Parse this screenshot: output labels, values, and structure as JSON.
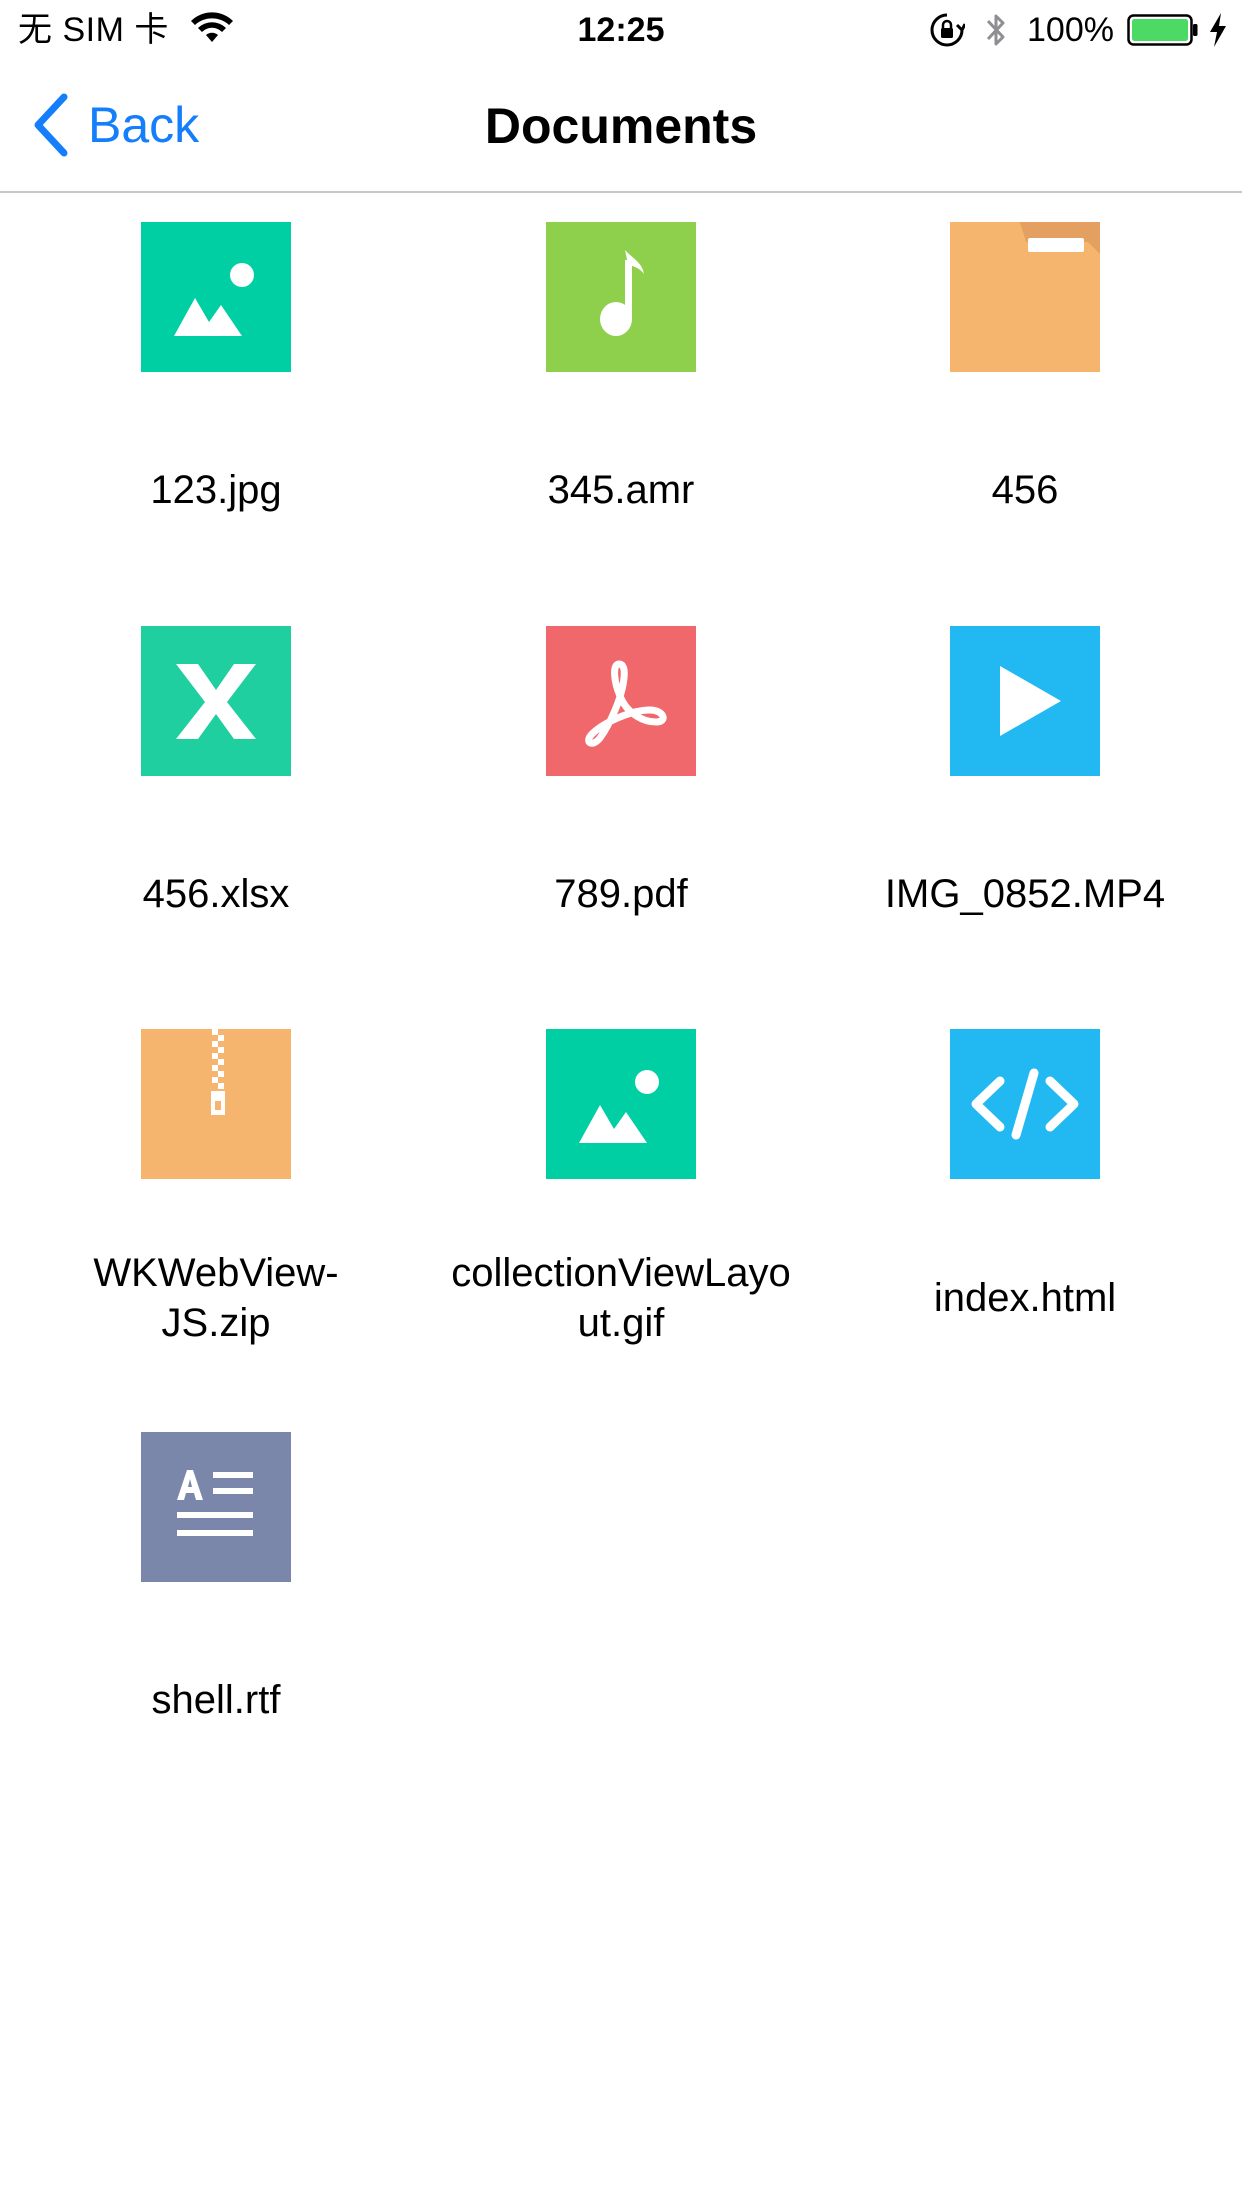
{
  "status_bar": {
    "carrier": "无 SIM 卡",
    "time": "12:25",
    "battery_percent": "100%",
    "battery_level": 1.0,
    "battery_color": "#4cd964",
    "icons": [
      "wifi-icon",
      "orientation-lock-icon",
      "bluetooth-icon",
      "battery-icon",
      "charging-bolt-icon"
    ]
  },
  "nav": {
    "back_label": "Back",
    "title": "Documents",
    "accent_color": "#147efb"
  },
  "files": [
    {
      "name": "123.jpg",
      "icon": "image-icon",
      "color": "#00cfa3"
    },
    {
      "name": "345.amr",
      "icon": "music-icon",
      "color": "#8ecf4c"
    },
    {
      "name": "456",
      "icon": "folder-icon",
      "color": "#f5b56f"
    },
    {
      "name": "456.xlsx",
      "icon": "excel-icon",
      "color": "#1fcfa0"
    },
    {
      "name": "789.pdf",
      "icon": "pdf-icon",
      "color": "#f0686b"
    },
    {
      "name": "IMG_0852.MP4",
      "icon": "video-play-icon",
      "color": "#22b9f2"
    },
    {
      "name_lines": [
        "WKWebView-",
        "JS.zip"
      ],
      "icon": "zip-icon",
      "color": "#f5b56f"
    },
    {
      "name_lines": [
        "collectionViewLayo",
        "ut.gif"
      ],
      "icon": "image-icon",
      "color": "#00cfa3"
    },
    {
      "name": "index.html",
      "icon": "code-icon",
      "color": "#22b9f2"
    },
    {
      "name": "shell.rtf",
      "icon": "text-document-icon",
      "color": "#7a87aa"
    }
  ]
}
